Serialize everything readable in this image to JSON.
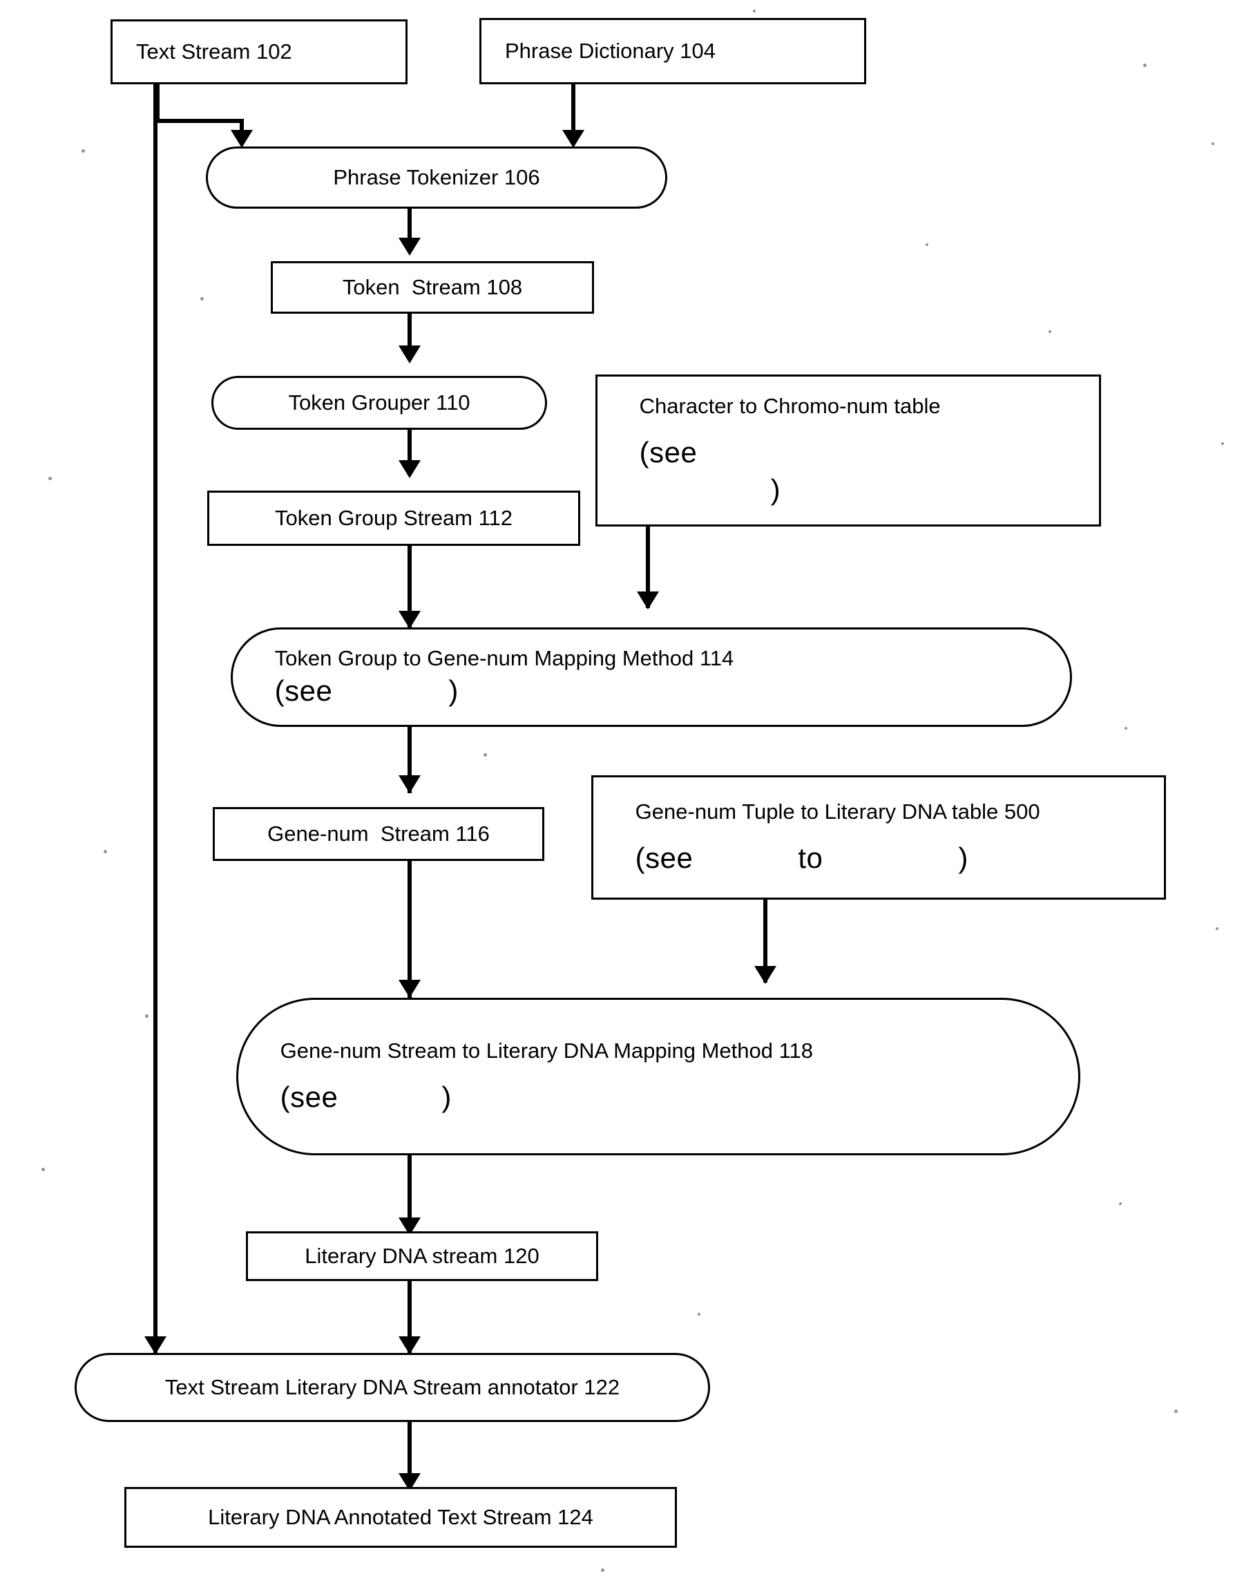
{
  "diagram": {
    "title": "Literary DNA text annotation pipeline flowchart",
    "ink_color": "#000000",
    "background_color": "#ffffff",
    "nodes": {
      "text_stream_102": "Text Stream 102",
      "phrase_dictionary_104": "Phrase Dictionary 104",
      "phrase_tokenizer_106": "Phrase Tokenizer 106",
      "token_stream_108": "Token  Stream 108",
      "token_grouper_110": "Token Grouper 110",
      "char_to_chromo_table_line1": "Character to Chromo-num table",
      "char_to_chromo_table_line2_open": "(see",
      "char_to_chromo_table_line2_close": ")",
      "token_group_stream_112": "Token Group Stream 112",
      "mapping_method_114_text": "Token Group to Gene-num Mapping Method 114",
      "mapping_method_114_see_open": "(see",
      "mapping_method_114_see_close": ")",
      "gene_num_stream_116": "Gene-num  Stream 116",
      "tuple_table_500_line1": "Gene-num Tuple to Literary DNA table 500",
      "tuple_table_500_see_open": "(see",
      "tuple_table_500_see_to": "to",
      "tuple_table_500_see_close": ")",
      "mapping_method_118_line1": "Gene-num Stream to Literary DNA Mapping Method 118",
      "mapping_method_118_see_open": "(see",
      "mapping_method_118_see_close": ")",
      "literary_dna_stream_120": "Literary DNA stream 120",
      "annotator_122": "Text Stream Literary DNA Stream annotator 122",
      "annotated_text_stream_124": "Literary DNA Annotated Text Stream 124"
    },
    "edges": [
      {
        "from": "text_stream_102",
        "to": "phrase_tokenizer_106"
      },
      {
        "from": "phrase_dictionary_104",
        "to": "phrase_tokenizer_106"
      },
      {
        "from": "phrase_tokenizer_106",
        "to": "token_stream_108"
      },
      {
        "from": "token_stream_108",
        "to": "token_grouper_110"
      },
      {
        "from": "token_grouper_110",
        "to": "token_group_stream_112"
      },
      {
        "from": "token_group_stream_112",
        "to": "mapping_method_114"
      },
      {
        "from": "char_to_chromo_table",
        "to": "mapping_method_114"
      },
      {
        "from": "mapping_method_114",
        "to": "gene_num_stream_116"
      },
      {
        "from": "gene_num_stream_116",
        "to": "mapping_method_118"
      },
      {
        "from": "tuple_table_500",
        "to": "mapping_method_118"
      },
      {
        "from": "mapping_method_118",
        "to": "literary_dna_stream_120"
      },
      {
        "from": "literary_dna_stream_120",
        "to": "annotator_122"
      },
      {
        "from": "text_stream_102",
        "to": "annotator_122"
      },
      {
        "from": "annotator_122",
        "to": "annotated_text_stream_124"
      }
    ]
  }
}
